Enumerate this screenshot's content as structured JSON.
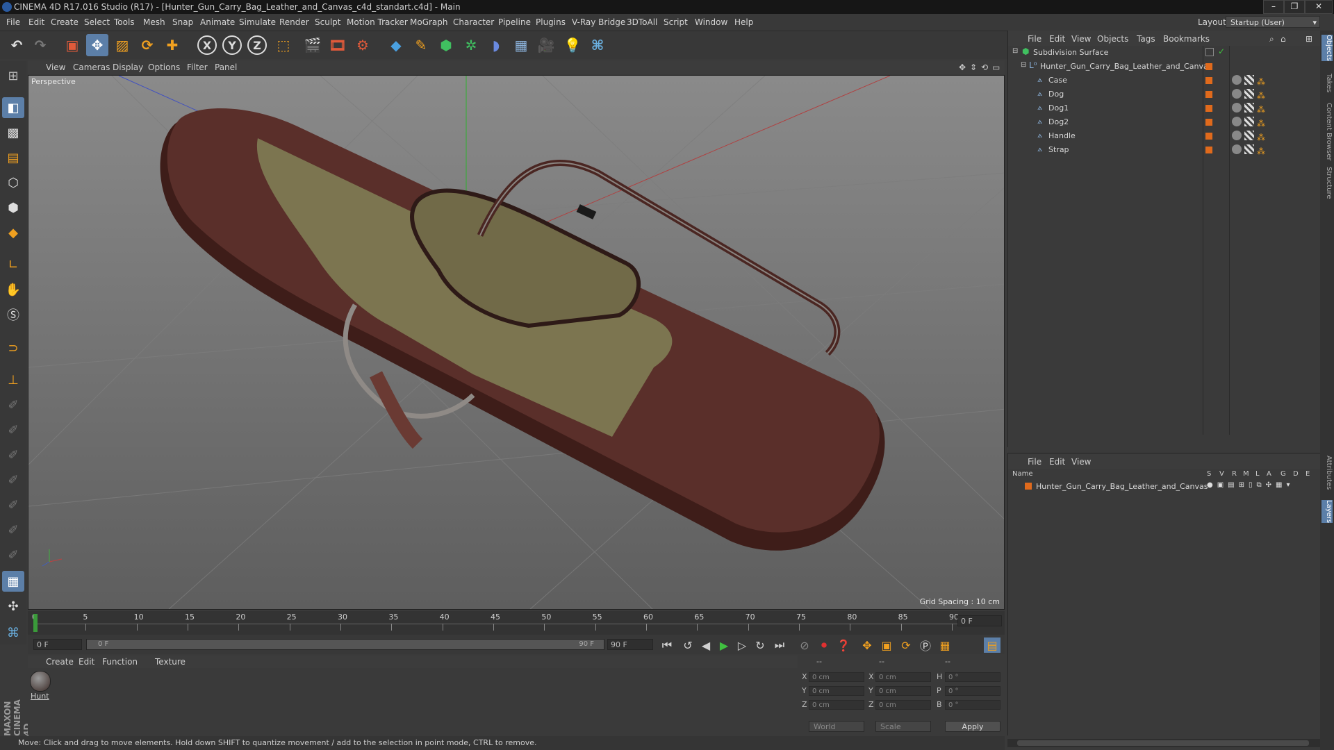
{
  "window": {
    "title": "CINEMA 4D R17.016 Studio (R17) - [Hunter_Gun_Carry_Bag_Leather_and_Canvas_c4d_standart.c4d] - Main"
  },
  "menubar": {
    "items": [
      "File",
      "Edit",
      "Create",
      "Select",
      "Tools",
      "Mesh",
      "Snap",
      "Animate",
      "Simulate",
      "Render",
      "Sculpt",
      "Motion Tracker",
      "MoGraph",
      "Character",
      "Pipeline",
      "Plugins",
      "V-Ray Bridge",
      "3DToAll",
      "Script",
      "Window",
      "Help"
    ],
    "layout_label": "Layout:",
    "layout_value": "Startup (User)"
  },
  "toolbar": {
    "axis_x": "X",
    "axis_y": "Y",
    "axis_z": "Z"
  },
  "viewport": {
    "menu": [
      "View",
      "Cameras",
      "Display",
      "Options",
      "Filter",
      "Panel"
    ],
    "label": "Perspective",
    "grid_spacing": "Grid Spacing : 10 cm"
  },
  "timeline": {
    "ticks": [
      "0",
      "5",
      "10",
      "15",
      "20",
      "25",
      "30",
      "35",
      "40",
      "45",
      "50",
      "55",
      "60",
      "65",
      "70",
      "75",
      "80",
      "85",
      "90"
    ],
    "current_frame": "0 F"
  },
  "transport": {
    "start_frame": "0 F",
    "range_start": "0 F",
    "range_end": "90 F",
    "end_frame": "90 F"
  },
  "material_panel": {
    "menu": [
      "Create",
      "Edit",
      "Function",
      "Texture"
    ],
    "materials": [
      {
        "label": "Hunt"
      }
    ]
  },
  "coordinates": {
    "headers": [
      "--",
      "--",
      "--"
    ],
    "rows": [
      {
        "axis": "X",
        "pos": "0 cm",
        "size_axis": "X",
        "size": "0 cm",
        "rot_axis": "H",
        "rot": "0 °"
      },
      {
        "axis": "Y",
        "pos": "0 cm",
        "size_axis": "Y",
        "size": "0 cm",
        "rot_axis": "P",
        "rot": "0 °"
      },
      {
        "axis": "Z",
        "pos": "0 cm",
        "size_axis": "Z",
        "size": "0 cm",
        "rot_axis": "B",
        "rot": "0 °"
      }
    ],
    "space_select": "World",
    "mode_select": "Scale",
    "apply_label": "Apply"
  },
  "status": {
    "text": "Move: Click and drag to move elements. Hold down SHIFT to quantize movement / add to the selection in point mode, CTRL to remove."
  },
  "object_manager": {
    "menu": [
      "File",
      "Edit",
      "View",
      "Objects",
      "Tags",
      "Bookmarks"
    ],
    "objects": [
      {
        "name": "Subdivision Surface"
      },
      {
        "name": "Hunter_Gun_Carry_Bag_Leather_and_Canvas"
      },
      {
        "name": "Case"
      },
      {
        "name": "Dog"
      },
      {
        "name": "Dog1"
      },
      {
        "name": "Dog2"
      },
      {
        "name": "Handle"
      },
      {
        "name": "Strap"
      }
    ]
  },
  "layer_manager": {
    "menu": [
      "File",
      "Edit",
      "View"
    ],
    "column_name": "Name",
    "columns": [
      "S",
      "V",
      "R",
      "M",
      "L",
      "A",
      "G",
      "D",
      "E"
    ],
    "layers": [
      {
        "name": "Hunter_Gun_Carry_Bag_Leather_and_Canvas"
      }
    ]
  },
  "right_tabs": [
    "Objects",
    "Takes",
    "Content Browser",
    "Structure",
    "Attributes",
    "Layers"
  ],
  "colors": {
    "selection_blue": "#5c7fa8",
    "layer_orange": "#e06a1c",
    "leather_brown": "#5a2f2a",
    "canvas_olive": "#7c7550"
  }
}
